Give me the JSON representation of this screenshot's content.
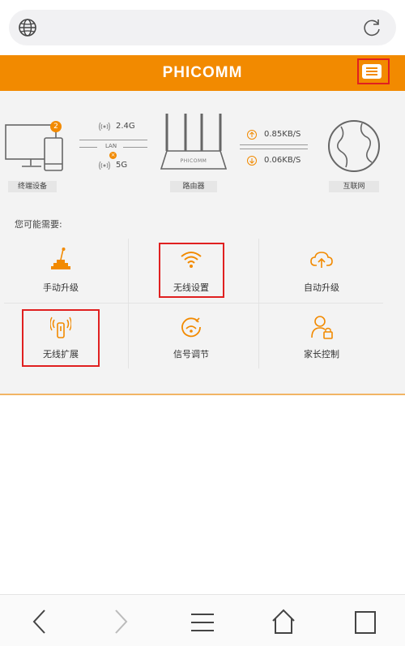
{
  "header": {
    "brand": "PHICOMM"
  },
  "topology": {
    "devices_label": "终端设备",
    "devices_count": "2",
    "band_24": "2.4G",
    "lan_label": "LAN",
    "band_5": "5G",
    "router_label": "路由器",
    "router_brand": "PHICOMM",
    "upload_speed": "0.85KB/S",
    "download_speed": "0.06KB/S",
    "internet_label": "互联网"
  },
  "section": {
    "title": "您可能需要:"
  },
  "tiles": [
    {
      "label": "手动升级",
      "icon": "manual-upgrade-icon"
    },
    {
      "label": "无线设置",
      "icon": "wifi-icon"
    },
    {
      "label": "自动升级",
      "icon": "cloud-upload-icon"
    },
    {
      "label": "无线扩展",
      "icon": "wireless-extender-icon"
    },
    {
      "label": "信号调节",
      "icon": "signal-adjust-icon"
    },
    {
      "label": "家长控制",
      "icon": "parental-control-icon"
    }
  ],
  "colors": {
    "accent": "#f28a00",
    "highlight": "#e02020"
  }
}
